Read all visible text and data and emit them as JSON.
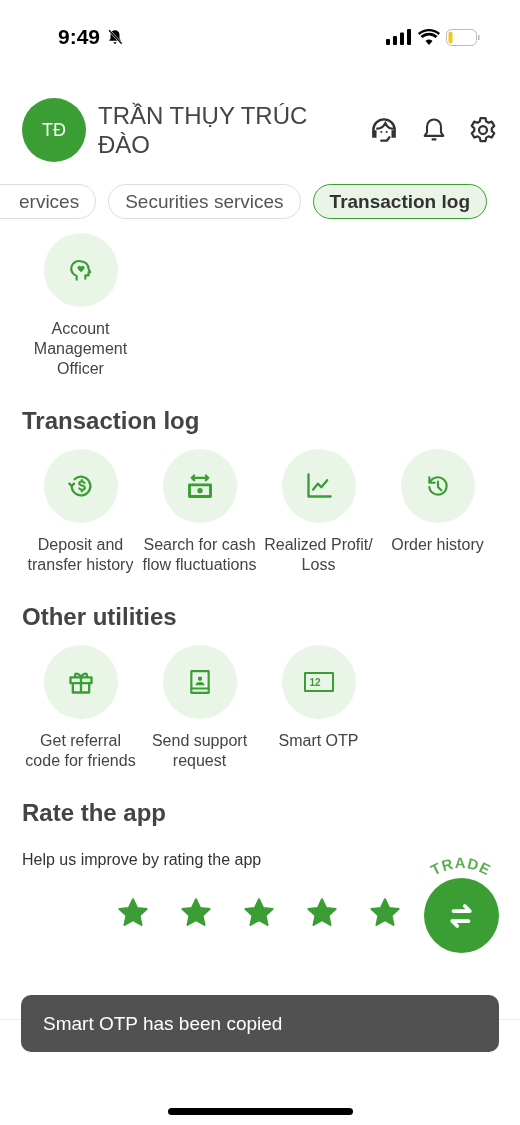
{
  "status_bar": {
    "time": "9:49"
  },
  "profile": {
    "initials": "TĐ",
    "name": "TRẦN THỤY TRÚC ĐÀO"
  },
  "tabs": [
    {
      "label": "ervices",
      "selected": false
    },
    {
      "label": "Securities services",
      "selected": false
    },
    {
      "label": "Transaction log",
      "selected": true
    }
  ],
  "top_items": [
    {
      "label": "Account Management Officer"
    }
  ],
  "sections": [
    {
      "title": "Transaction log",
      "items": [
        {
          "label": "Deposit and transfer history"
        },
        {
          "label": "Search for cash flow fluctuations"
        },
        {
          "label": "Realized Profit/ Loss"
        },
        {
          "label": "Order history"
        }
      ]
    },
    {
      "title": "Other utilities",
      "items": [
        {
          "label": "Get referral code for friends"
        },
        {
          "label": "Send support request"
        },
        {
          "label": "Smart OTP",
          "badge": "12"
        }
      ]
    }
  ],
  "rating": {
    "title": "Rate the app",
    "subtitle": "Help us improve by rating the app",
    "stars": 5
  },
  "trade_button": {
    "label": "TRADE"
  },
  "toast": {
    "message": "Smart OTP has been copied"
  }
}
